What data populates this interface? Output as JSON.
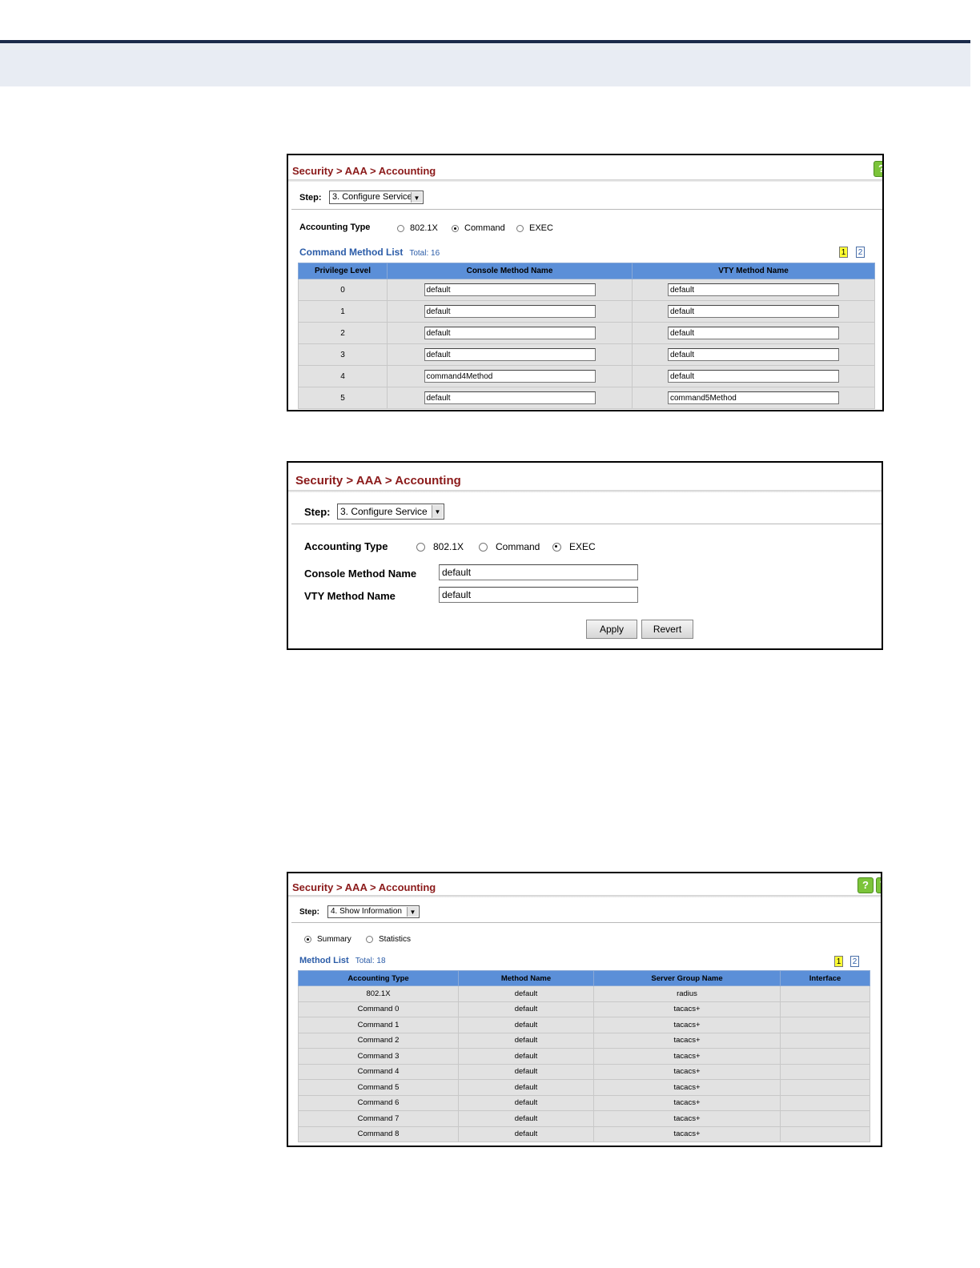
{
  "panel1": {
    "breadcrumb": [
      "Security",
      "AAA",
      "Accounting"
    ],
    "step_label": "Step:",
    "step_value": "3. Configure Service",
    "accounting_type_label": "Accounting Type",
    "radios": [
      {
        "label": "802.1X",
        "selected": false
      },
      {
        "label": "Command",
        "selected": true
      },
      {
        "label": "EXEC",
        "selected": false
      }
    ],
    "list_title": "Command Method List",
    "total": "Total: 16",
    "pages": [
      "1",
      "2"
    ],
    "headers": [
      "Privilege Level",
      "Console Method Name",
      "VTY Method Name"
    ],
    "rows": [
      {
        "level": "0",
        "console": "default",
        "vty": "default"
      },
      {
        "level": "1",
        "console": "default",
        "vty": "default"
      },
      {
        "level": "2",
        "console": "default",
        "vty": "default"
      },
      {
        "level": "3",
        "console": "default",
        "vty": "default"
      },
      {
        "level": "4",
        "console": "command4Method",
        "vty": "default"
      },
      {
        "level": "5",
        "console": "default",
        "vty": "command5Method"
      }
    ]
  },
  "panel2": {
    "breadcrumb": [
      "Security",
      "AAA",
      "Accounting"
    ],
    "step_label": "Step:",
    "step_value": "3. Configure Service",
    "accounting_type_label": "Accounting Type",
    "radios": [
      {
        "label": "802.1X",
        "selected": false
      },
      {
        "label": "Command",
        "selected": false
      },
      {
        "label": "EXEC",
        "selected": true
      }
    ],
    "console_label": "Console Method Name",
    "console_value": "default",
    "vty_label": "VTY Method Name",
    "vty_value": "default",
    "apply_label": "Apply",
    "revert_label": "Revert"
  },
  "panel3": {
    "breadcrumb": [
      "Security",
      "AAA",
      "Accounting"
    ],
    "step_label": "Step:",
    "step_value": "4. Show Information",
    "radios": [
      {
        "label": "Summary",
        "selected": true
      },
      {
        "label": "Statistics",
        "selected": false
      }
    ],
    "list_title": "Method List",
    "total": "Total: 18",
    "pages": [
      "1",
      "2"
    ],
    "headers": [
      "Accounting Type",
      "Method Name",
      "Server Group Name",
      "Interface"
    ],
    "rows": [
      {
        "type": "802.1X",
        "method": "default",
        "group": "radius",
        "iface": ""
      },
      {
        "type": "Command 0",
        "method": "default",
        "group": "tacacs+",
        "iface": ""
      },
      {
        "type": "Command 1",
        "method": "default",
        "group": "tacacs+",
        "iface": ""
      },
      {
        "type": "Command 2",
        "method": "default",
        "group": "tacacs+",
        "iface": ""
      },
      {
        "type": "Command 3",
        "method": "default",
        "group": "tacacs+",
        "iface": ""
      },
      {
        "type": "Command 4",
        "method": "default",
        "group": "tacacs+",
        "iface": ""
      },
      {
        "type": "Command 5",
        "method": "default",
        "group": "tacacs+",
        "iface": ""
      },
      {
        "type": "Command 6",
        "method": "default",
        "group": "tacacs+",
        "iface": ""
      },
      {
        "type": "Command 7",
        "method": "default",
        "group": "tacacs+",
        "iface": ""
      },
      {
        "type": "Command 8",
        "method": "default",
        "group": "tacacs+",
        "iface": ""
      }
    ]
  }
}
